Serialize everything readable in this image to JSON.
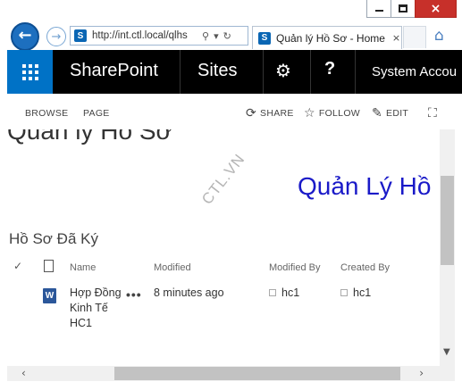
{
  "browser": {
    "back_glyph": "←",
    "forward_glyph": "→",
    "address_text": "http://int.ctl.local/qlhs",
    "address_sp_badge": "S",
    "address_search_glyph": "⚲",
    "address_dropdown_glyph": "▾",
    "address_refresh_glyph": "↻",
    "tab_title": "Quản lý Hồ Sơ - Home",
    "tab_close_glyph": "×",
    "home_glyph": "⌂",
    "window_close_glyph": "×",
    "icons": [
      "back-icon",
      "forward-icon",
      "search-icon",
      "refresh-icon",
      "home-icon",
      "close-icon"
    ]
  },
  "suite_bar": {
    "brand": "SharePoint",
    "sites": "Sites",
    "gear_glyph": "⚙",
    "help_glyph": "?",
    "account": "System Accou"
  },
  "ribbon": {
    "tabs": [
      "BROWSE",
      "PAGE"
    ],
    "share": "SHARE",
    "follow": "FOLLOW",
    "edit": "EDIT",
    "share_glyph": "⟳",
    "follow_glyph": "☆",
    "edit_glyph": "✎",
    "focus_glyph": "⛶"
  },
  "page": {
    "title": "Quản lý Hồ Sơ",
    "banner": "Quản Lý Hồ",
    "watermark": "CTL.VN"
  },
  "list": {
    "title": "Hồ Sơ Đã Ký",
    "check_glyph": "✓",
    "columns": [
      "Name",
      "Modified",
      "Modified By",
      "Created By"
    ],
    "rows": [
      {
        "name": "Hợp Đồng Kinh Tế HC1",
        "modified": "8 minutes ago",
        "modified_by": "hc1",
        "created_by": "hc1",
        "dots": "•••",
        "type_badge": "W"
      }
    ]
  },
  "scroll": {
    "up_glyph": "▲",
    "down_glyph": "▼",
    "left_glyph": "‹",
    "right_glyph": "›"
  },
  "colors": {
    "suite_bar": "#000000",
    "app_launcher": "#0072c6",
    "banner_text": "#1a1ac8",
    "close_button": "#c7302a"
  }
}
